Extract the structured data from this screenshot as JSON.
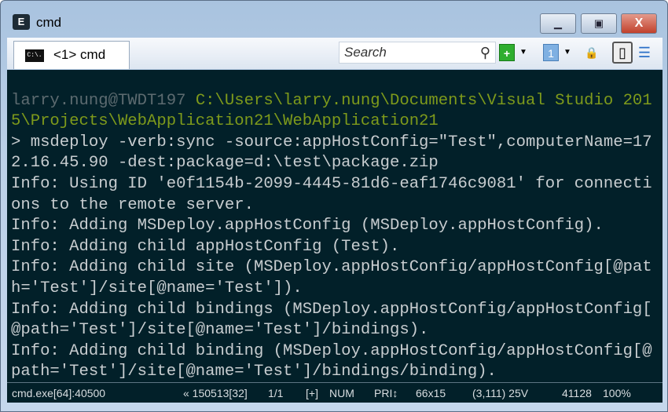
{
  "window": {
    "title": "cmd",
    "minimize": "▁",
    "maximize": "▣",
    "close": "X"
  },
  "tab": {
    "label": "<1> cmd",
    "icon_text": "C:\\."
  },
  "search": {
    "placeholder": "Search",
    "icon": "⚲"
  },
  "toolbar": {
    "new_icon": "+",
    "arrow": "▼",
    "one_icon": "1",
    "lock_icon": "🔒",
    "panel_icon": "▯",
    "menu_icon": "☰"
  },
  "console": {
    "lines": [
      [
        {
          "t": "",
          "c": "n"
        }
      ],
      [
        {
          "t": "larry.nung@TWDT197 ",
          "c": "u"
        },
        {
          "t": "C:\\Users\\larry.nung\\Documents\\Visual Studio 201",
          "c": "p"
        }
      ],
      [
        {
          "t": "5\\Projects\\WebApplication21\\WebApplication21",
          "c": "p"
        }
      ],
      [
        {
          "t": "> msdeploy -verb:sync -source:appHostConfig=\"Test\",computerName=17",
          "c": "n"
        }
      ],
      [
        {
          "t": "2.16.45.90 -dest:package=d:\\test\\package.zip",
          "c": "n"
        }
      ],
      [
        {
          "t": "Info: Using ID 'e0f1154b-2099-4445-81d6-eaf1746c9081' for connecti",
          "c": "n"
        }
      ],
      [
        {
          "t": "ons to the remote server.",
          "c": "n"
        }
      ],
      [
        {
          "t": "Info: Adding MSDeploy.appHostConfig (MSDeploy.appHostConfig).",
          "c": "n"
        }
      ],
      [
        {
          "t": "Info: Adding child appHostConfig (Test).",
          "c": "n"
        }
      ],
      [
        {
          "t": "Info: Adding child site (MSDeploy.appHostConfig/appHostConfig[@pat",
          "c": "n"
        }
      ],
      [
        {
          "t": "h='Test']/site[@name='Test']).",
          "c": "n"
        }
      ],
      [
        {
          "t": "Info: Adding child bindings (MSDeploy.appHostConfig/appHostConfig[",
          "c": "n"
        }
      ],
      [
        {
          "t": "@path='Test']/site[@name='Test']/bindings).",
          "c": "n"
        }
      ],
      [
        {
          "t": "Info: Adding child binding (MSDeploy.appHostConfig/appHostConfig[@",
          "c": "n"
        }
      ],
      [
        {
          "t": "path='Test']/site[@name='Test']/bindings/binding).",
          "c": "n"
        }
      ]
    ]
  },
  "status": {
    "process": "cmd.exe[64]:40500",
    "buffer": "« 150513[32]",
    "console_index": "1/1",
    "plus": "[+]",
    "num": "NUM",
    "pri": "PRI↕",
    "size": "66x15",
    "cursor": "(3,111) 25V",
    "pid": "41128",
    "zoom": "100%"
  },
  "colors": {
    "bg": "#022029",
    "user": "#5d6b70",
    "path": "#7e9a1b",
    "text": "#c8cdd0"
  }
}
